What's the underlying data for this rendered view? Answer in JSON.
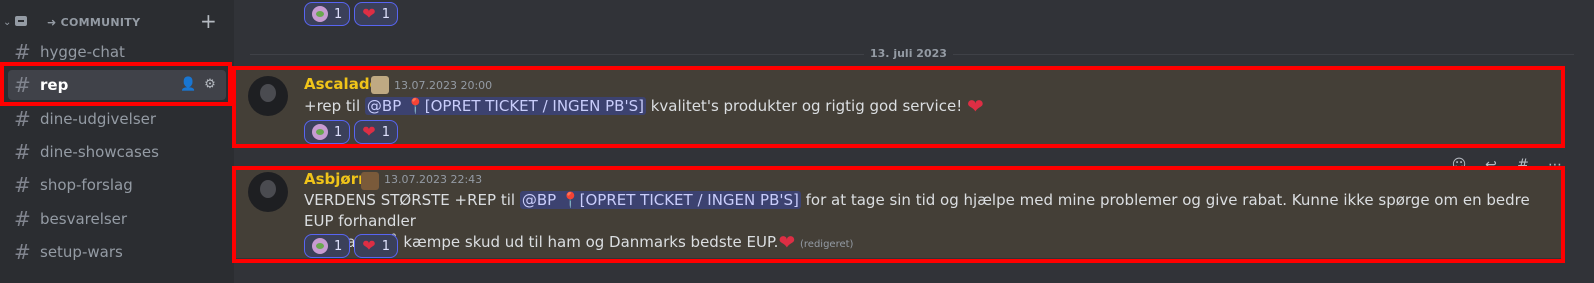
{
  "sidebar": {
    "category": {
      "label": "➜ COMMUNITY",
      "chevron": "⌄",
      "add": "+"
    },
    "channels": [
      {
        "name": "hygge-chat",
        "active": false
      },
      {
        "name": "rep",
        "active": true
      },
      {
        "name": "dine-udgivelser",
        "active": false
      },
      {
        "name": "dine-showcases",
        "active": false
      },
      {
        "name": "shop-forslag",
        "active": false
      },
      {
        "name": "besvarelser",
        "active": false
      },
      {
        "name": "setup-wars",
        "active": false
      }
    ],
    "hash": "#",
    "active_actions": {
      "invite": "👤",
      "settings": "⚙"
    }
  },
  "main": {
    "top_reactions": [
      {
        "icon": "frog-emoji",
        "count": "1"
      },
      {
        "icon": "heart-emoji",
        "count": "1"
      }
    ],
    "date_divider": "13. juli 2023",
    "messages": [
      {
        "author": "Ascalade",
        "timestamp": "13.07.2023 20:00",
        "text_before": "+rep til ",
        "mention": "@BP",
        "mention_role": "[OPRET TICKET / INGEN PB'S]",
        "text_after": " kvalitet's produkter og rigtig god service! ",
        "heart": "❤",
        "reactions": [
          {
            "icon": "frog-emoji",
            "count": "1"
          },
          {
            "icon": "heart-emoji",
            "count": "1"
          }
        ]
      },
      {
        "author": "Asbjørn",
        "timestamp": "13.07.2023 22:43",
        "text_before": "VERDENS STØRSTE +REP til ",
        "mention": "@BP",
        "mention_role": "[OPRET TICKET / INGEN PB'S]",
        "text_after": " for at tage sin tid og hjælpe med mine problemer og give rabat. Kunne ikke spørge om en bedre EUP forhandler",
        "line2": "end ham. Så kæmpe skud ud til ham og Danmarks bedste EUP.",
        "heart": "❤",
        "edited": "(redigeret)",
        "reactions": [
          {
            "icon": "frog-emoji",
            "count": "1"
          },
          {
            "icon": "heart-emoji",
            "count": "1"
          }
        ]
      }
    ],
    "toolbar": {
      "react": "☺",
      "reply": "↩",
      "thread": "#",
      "more": "⋯"
    }
  },
  "colors": {
    "mention_pin": "#f04747",
    "author": "#f0c419",
    "highlight_box": "#ff0000"
  }
}
